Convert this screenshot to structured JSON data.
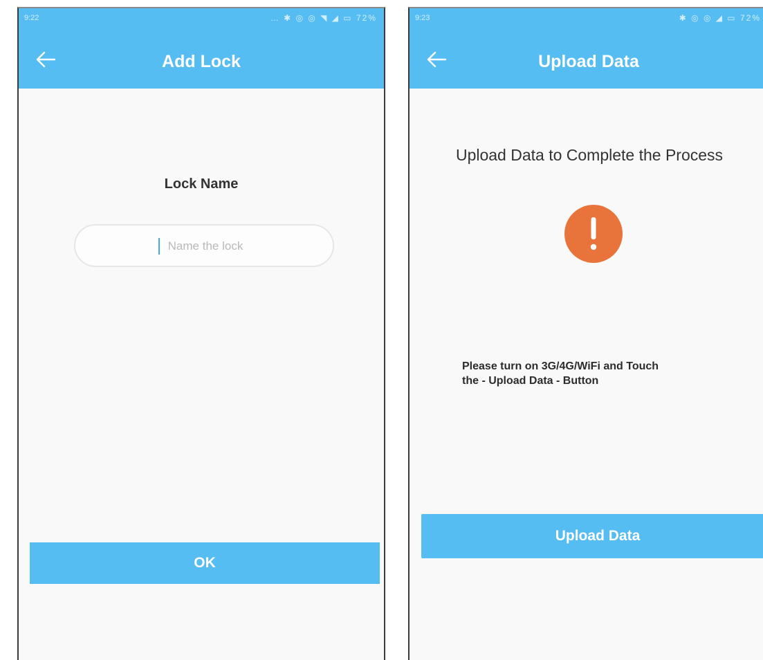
{
  "screens": {
    "add_lock": {
      "status": {
        "time": "9:22",
        "icons": "… ✱ ◎ ◎ ◥ ◢ ▭ 72%"
      },
      "title": "Add Lock",
      "lock_name_label": "Lock Name",
      "name_input": {
        "placeholder": "Name the lock",
        "value": ""
      },
      "ok_label": "OK"
    },
    "upload_data": {
      "status": {
        "time": "9:23",
        "icons": "✱ ◎ ◎ ◢ ▭ 72%"
      },
      "title": "Upload Data",
      "heading": "Upload Data to Complete the Process",
      "alert_icon": "exclamation-icon",
      "instruction_line1": "Please turn on 3G/4G/WiFi and Touch",
      "instruction_line2": "the - Upload Data - Button",
      "upload_label": "Upload Data"
    }
  },
  "colors": {
    "accent": "#56bdf2",
    "alert": "#e9743b",
    "background": "#f9f9fa"
  }
}
